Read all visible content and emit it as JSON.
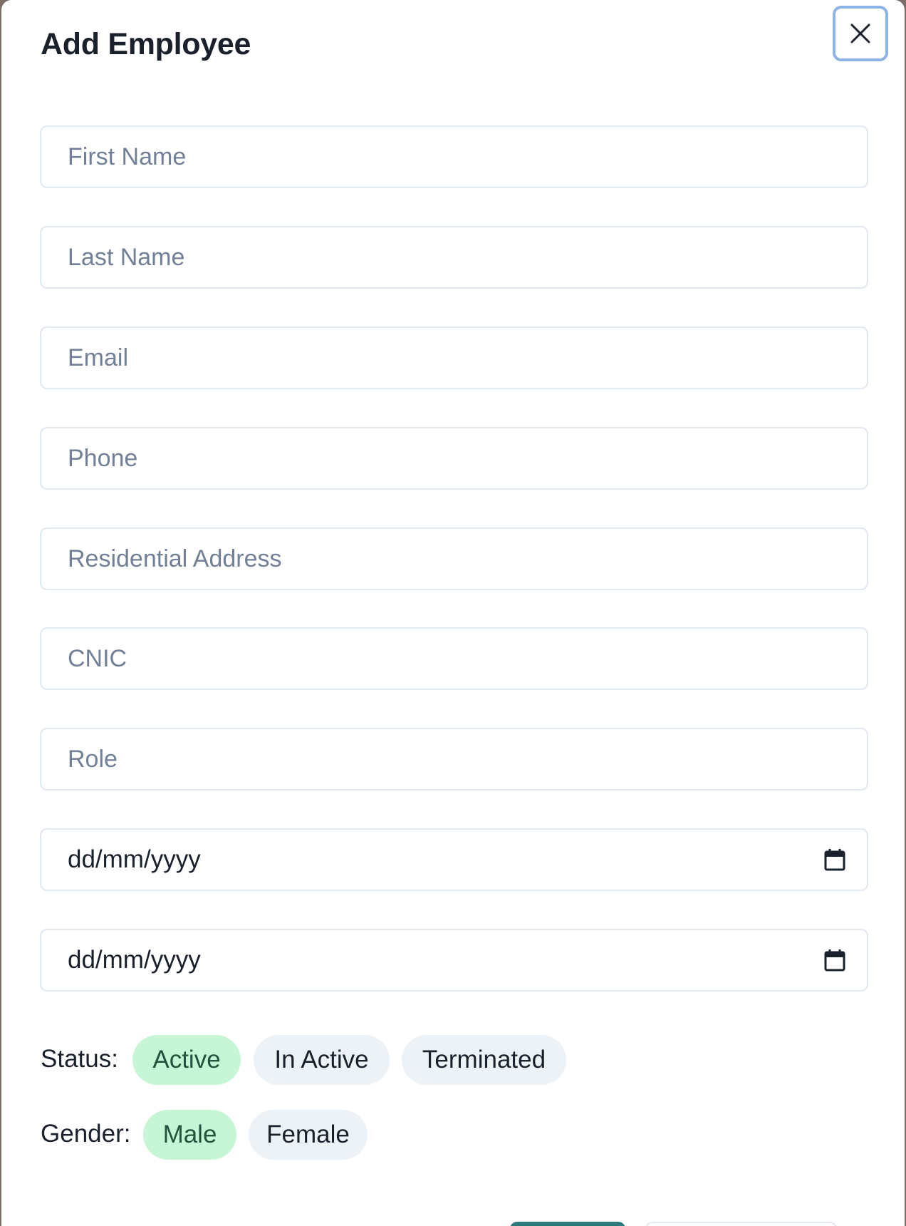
{
  "modal": {
    "title": "Add Employee"
  },
  "fields": {
    "first_name": {
      "placeholder": "First Name",
      "value": ""
    },
    "last_name": {
      "placeholder": "Last Name",
      "value": ""
    },
    "email": {
      "placeholder": "Email",
      "value": ""
    },
    "phone": {
      "placeholder": "Phone",
      "value": ""
    },
    "address": {
      "placeholder": "Residential Address",
      "value": ""
    },
    "cnic": {
      "placeholder": "CNIC",
      "value": ""
    },
    "role": {
      "placeholder": "Role",
      "value": ""
    },
    "date_1": {
      "value": "dd/mm/yyyy"
    },
    "date_2": {
      "value": "dd/mm/yyyy"
    }
  },
  "status": {
    "label": "Status:",
    "options": [
      "Active",
      "In Active",
      "Terminated"
    ],
    "selected": "Active"
  },
  "gender": {
    "label": "Gender:",
    "options": [
      "Male",
      "Female"
    ],
    "selected": "Male"
  },
  "icons": {
    "close": "close-icon",
    "calendar": "calendar-icon"
  },
  "colors": {
    "selected_chip_bg": "#c6f6d5",
    "selected_chip_text": "#22543d",
    "chip_bg": "#edf2f7",
    "primary_button": "#2c7a7b",
    "focus_ring": "#8fb3e6"
  }
}
